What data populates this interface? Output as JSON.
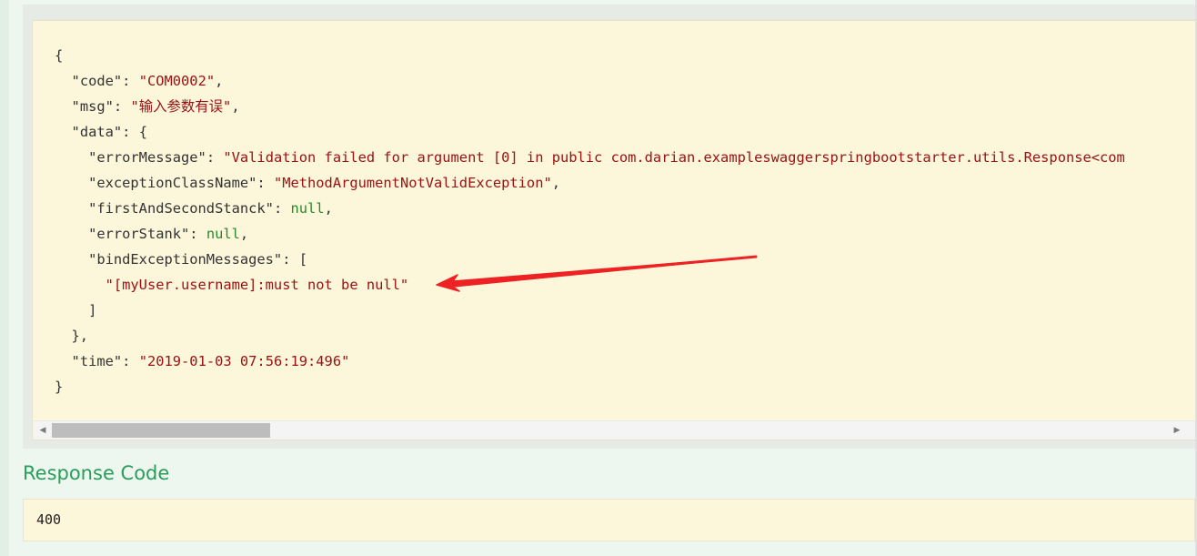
{
  "response_body": {
    "line_open": "{",
    "code_key": "\"code\"",
    "code_val": "\"COM0002\"",
    "msg_key": "\"msg\"",
    "msg_val": "\"输入参数有误\"",
    "data_key": "\"data\"",
    "error_message_key": "\"errorMessage\"",
    "error_message_val": "\"Validation failed for argument [0] in public com.darian.exampleswaggerspringbootstarter.utils.Response<com",
    "exception_class_key": "\"exceptionClassName\"",
    "exception_class_val": "\"MethodArgumentNotValidException\"",
    "first_second_key": "\"firstAndSecondStanck\"",
    "first_second_val": "null",
    "error_stank_key": "\"errorStank\"",
    "error_stank_val": "null",
    "bind_messages_key": "\"bindExceptionMessages\"",
    "bind_message_0": "\"[myUser.username]:must not be null\"",
    "time_key": "\"time\"",
    "time_val": "\"2019-01-03 07:56:19:496\"",
    "line_close": "}"
  },
  "scrollbar": {
    "left_arrow": "◀",
    "right_arrow": "▶"
  },
  "response_code": {
    "title": "Response Code",
    "value": "400"
  },
  "colors": {
    "annotation_arrow": "#ee2222",
    "title_green": "#2a9d5a",
    "code_background": "#fcf6db"
  }
}
